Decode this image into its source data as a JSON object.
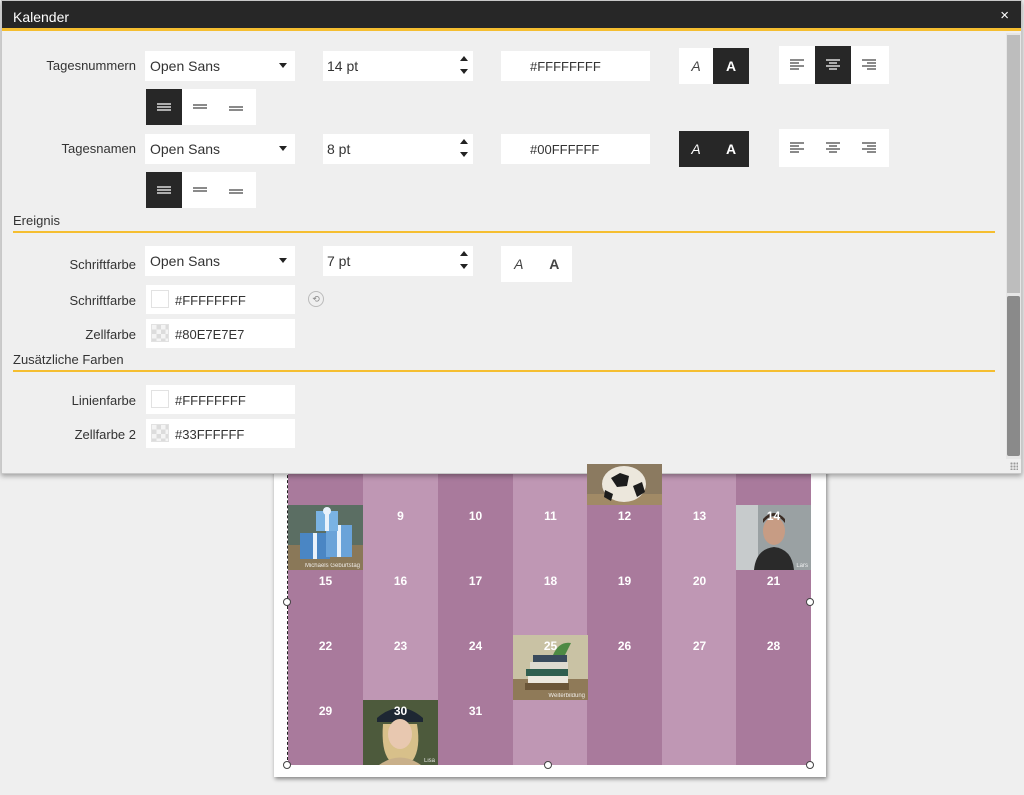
{
  "dialog": {
    "title": "Kalender",
    "close_glyph": "×",
    "rows": [
      {
        "label": "Tagesnummern",
        "font": "Open Sans",
        "size": "14 pt",
        "color": "#FFFFFFFF",
        "style_italic": "A",
        "style_bold": "A",
        "italic_active": false,
        "bold_active": true,
        "h_align_active": "center",
        "v_align_active": "top"
      },
      {
        "label": "Tagesnamen",
        "font": "Open Sans",
        "size": "8 pt",
        "color": "#00FFFFFF",
        "style_italic": "A",
        "style_bold": "A",
        "italic_active": true,
        "bold_active": true,
        "h_align_active": "none",
        "v_align_active": "top"
      }
    ],
    "event_section": {
      "title": "Ereignis",
      "font_label": "Schriftfarbe",
      "font": "Open Sans",
      "size": "7 pt",
      "style_italic": "A",
      "style_bold": "A",
      "color_label": "Schriftfarbe",
      "color_value": "#FFFFFFFF",
      "cell_label": "Zellfarbe",
      "cell_value": "#80E7E7E7"
    },
    "extra_section": {
      "title": "Zusätzliche Farben",
      "line_label": "Linienfarbe",
      "line_value": "#FFFFFFFF",
      "cell2_label": "Zellfarbe 2",
      "cell2_value": "#33FFFFFF"
    }
  },
  "calendar": {
    "colors": {
      "dark": "#a97a9c",
      "light": "#bf97b4"
    },
    "week1": {
      "numbers": [
        "",
        "9",
        "10",
        "11",
        "12",
        "13",
        "14"
      ]
    },
    "week2": {
      "numbers": [
        "15",
        "16",
        "17",
        "18",
        "19",
        "20",
        "21"
      ]
    },
    "week3": {
      "numbers": [
        "22",
        "23",
        "24",
        "25",
        "26",
        "27",
        "28"
      ]
    },
    "week4": {
      "numbers": [
        "29",
        "30",
        "31",
        "",
        "",
        "",
        ""
      ]
    },
    "photos": [
      {
        "day": "8",
        "subject": "gifts",
        "caption": "Michaels Geburtstag"
      },
      {
        "day": "14",
        "subject": "man portrait",
        "caption": "Lars"
      },
      {
        "day": "25",
        "subject": "books",
        "caption": "Weiterbildung"
      },
      {
        "day": "30",
        "subject": "woman portrait",
        "caption": "Lisa"
      }
    ]
  }
}
